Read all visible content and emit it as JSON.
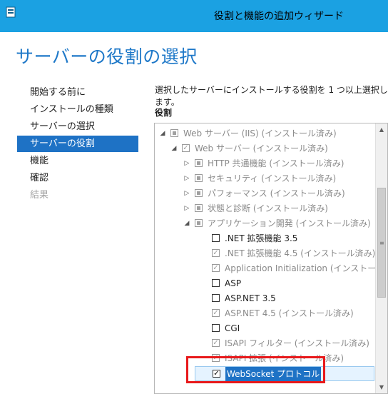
{
  "window": {
    "title": "役割と機能の追加ウィザード"
  },
  "heading": "サーバーの役割の選択",
  "nav": {
    "items": [
      {
        "label": "開始する前に",
        "state": "normal"
      },
      {
        "label": "インストールの種類",
        "state": "normal"
      },
      {
        "label": "サーバーの選択",
        "state": "normal"
      },
      {
        "label": "サーバーの役割",
        "state": "active"
      },
      {
        "label": "機能",
        "state": "normal"
      },
      {
        "label": "確認",
        "state": "normal"
      },
      {
        "label": "結果",
        "state": "disabled"
      }
    ]
  },
  "main": {
    "description": "選択したサーバーにインストールする役割を 1 つ以上選択します。",
    "roles_label": "役割"
  },
  "tree": {
    "rows": [
      {
        "label": "Web サーバー (IIS) (インストール済み)",
        "level": 0,
        "expander": "◢",
        "check": "partial",
        "gray": true
      },
      {
        "label": "Web サーバー (インストール済み)",
        "level": 1,
        "expander": "◢",
        "check": "checked-gray",
        "gray": true
      },
      {
        "label": "HTTP 共通機能 (インストール済み)",
        "level": 2,
        "expander": "▷",
        "check": "partial",
        "gray": true
      },
      {
        "label": "セキュリティ (インストール済み)",
        "level": 2,
        "expander": "▷",
        "check": "partial",
        "gray": true
      },
      {
        "label": "パフォーマンス (インストール済み)",
        "level": 2,
        "expander": "▷",
        "check": "partial",
        "gray": true
      },
      {
        "label": "状態と診断 (インストール済み)",
        "level": 2,
        "expander": "▷",
        "check": "partial",
        "gray": true
      },
      {
        "label": "アプリケーション開発 (インストール済み)",
        "level": 2,
        "expander": "◢",
        "check": "partial",
        "gray": true
      },
      {
        "label": ".NET 拡張機能 3.5",
        "level": 3,
        "expander": "",
        "check": "empty",
        "gray": false
      },
      {
        "label": ".NET 拡張機能 4.5 (インストール済み)",
        "level": 3,
        "expander": "",
        "check": "checked-gray",
        "gray": true
      },
      {
        "label": "Application Initialization (インストール済",
        "level": 3,
        "expander": "",
        "check": "checked-gray",
        "gray": true
      },
      {
        "label": "ASP",
        "level": 3,
        "expander": "",
        "check": "empty",
        "gray": false
      },
      {
        "label": "ASP.NET 3.5",
        "level": 3,
        "expander": "",
        "check": "empty",
        "gray": false
      },
      {
        "label": "ASP.NET 4.5 (インストール済み)",
        "level": 3,
        "expander": "",
        "check": "checked-gray",
        "gray": true
      },
      {
        "label": "CGI",
        "level": 3,
        "expander": "",
        "check": "empty",
        "gray": false
      },
      {
        "label": "ISAPI フィルター (インストール済み)",
        "level": 3,
        "expander": "",
        "check": "checked-gray",
        "gray": true
      },
      {
        "label": "ISAPI 拡張 (インストール済み)",
        "level": 3,
        "expander": "",
        "check": "checked-gray",
        "gray": true
      },
      {
        "label": "WebSocket プロトコル",
        "level": 3,
        "expander": "",
        "check": "checked",
        "gray": false,
        "selected": true
      }
    ]
  },
  "colors": {
    "titlebar": "#1ba1e2",
    "heading": "#1e78c8",
    "nav_active": "#1e72c5",
    "highlight": "#e8191b"
  }
}
